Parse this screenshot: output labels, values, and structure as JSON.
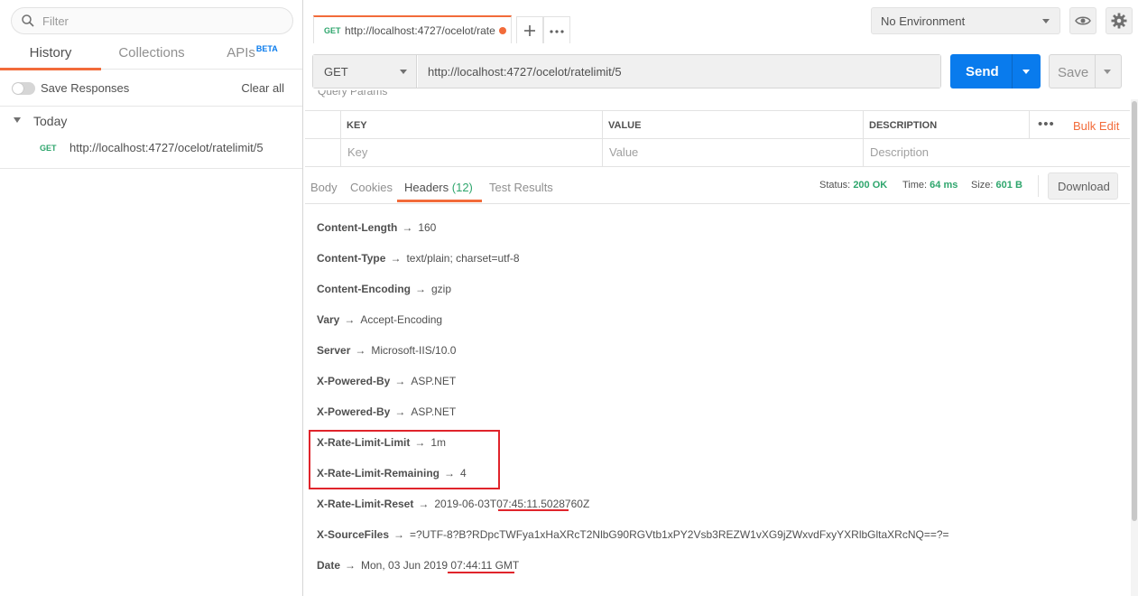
{
  "sidebar": {
    "filter_placeholder": "Filter",
    "tabs": [
      {
        "label": "History",
        "active": true
      },
      {
        "label": "Collections",
        "active": false
      },
      {
        "label": "APIs",
        "active": false,
        "badge": "BETA"
      }
    ],
    "save_responses_label": "Save Responses",
    "save_responses_on": false,
    "clear_all_label": "Clear all",
    "group_label": "Today",
    "history_items": [
      {
        "method": "GET",
        "url": "http://localhost:4727/ocelot/ratelimit/5"
      }
    ]
  },
  "topbar": {
    "tab": {
      "method": "GET",
      "title": "http://localhost:4727/ocelot/rate",
      "unsaved": true
    },
    "environment": "No Environment"
  },
  "request": {
    "method": "GET",
    "url": "http://localhost:4727/ocelot/ratelimit/5",
    "send_label": "Send",
    "save_label": "Save"
  },
  "params": {
    "section_title": "Query Params",
    "columns": [
      "KEY",
      "VALUE",
      "DESCRIPTION"
    ],
    "placeholders": {
      "key": "Key",
      "value": "Value",
      "description": "Description"
    },
    "bulk_edit_label": "Bulk Edit",
    "more_label": "•••"
  },
  "response": {
    "tabs": [
      {
        "label": "Body",
        "count": ""
      },
      {
        "label": "Cookies",
        "count": ""
      },
      {
        "label": "Headers",
        "count": "(12)"
      },
      {
        "label": "Test Results",
        "count": ""
      }
    ],
    "status_label": "Status:",
    "status_value": "200 OK",
    "time_label": "Time:",
    "time_value": "64 ms",
    "size_label": "Size:",
    "size_value": "601 B",
    "download_label": "Download",
    "headers": [
      {
        "key": "Content-Length",
        "value": "160"
      },
      {
        "key": "Content-Type",
        "value": "text/plain; charset=utf-8"
      },
      {
        "key": "Content-Encoding",
        "value": "gzip"
      },
      {
        "key": "Vary",
        "value": "Accept-Encoding"
      },
      {
        "key": "Server",
        "value": "Microsoft-IIS/10.0"
      },
      {
        "key": "X-Powered-By",
        "value": "ASP.NET"
      },
      {
        "key": "X-Powered-By",
        "value": "ASP.NET"
      },
      {
        "key": "X-Rate-Limit-Limit",
        "value": "1m"
      },
      {
        "key": "X-Rate-Limit-Remaining",
        "value": "4"
      },
      {
        "key": "X-Rate-Limit-Reset",
        "value": "2019-06-03T07:45:11.5028760Z"
      },
      {
        "key": "X-SourceFiles",
        "value": "=?UTF-8?B?RDpcTWFya1xHaXRcT2NlbG90RGVtb1xPY2Vsb3REZW1vXG9jZWxvdFxyYXRlbGltaXRcNQ==?="
      },
      {
        "key": "Date",
        "value": "Mon, 03 Jun 2019 07:44:11 GMT"
      }
    ],
    "arrow": "→"
  },
  "colors": {
    "accent_orange": "#f26b3a",
    "send_blue": "#097bed",
    "status_green": "#2fa66d",
    "annotation_red": "#e0242b"
  }
}
